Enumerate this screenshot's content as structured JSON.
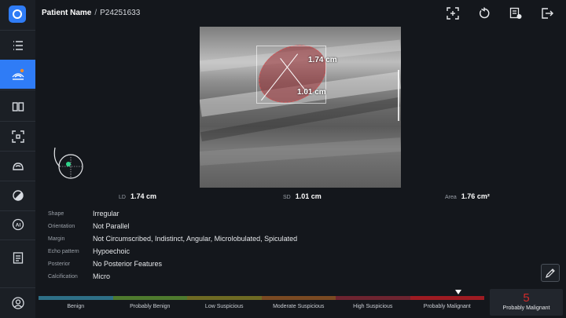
{
  "header": {
    "patient_label": "Patient Name",
    "separator": "/",
    "patient_id": "P24251633"
  },
  "sidebar": {
    "items": [
      {
        "icon": "list-icon"
      },
      {
        "icon": "ultrasound-probe-icon",
        "active": true
      },
      {
        "icon": "compare-icon"
      },
      {
        "icon": "focus-scan-icon"
      },
      {
        "icon": "breast-icon"
      },
      {
        "icon": "contrast-icon"
      },
      {
        "icon": "ai-icon"
      },
      {
        "icon": "clipboard-icon"
      },
      {
        "icon": "user-icon"
      }
    ]
  },
  "toolbar": {
    "icons": [
      "add-fullscreen-icon",
      "refresh-icon",
      "report-icon",
      "exit-icon"
    ]
  },
  "image": {
    "long_label": "1.74 cm",
    "short_label": "1.01 cm"
  },
  "measurements": {
    "ld_label": "LD",
    "ld_value": "1.74 cm",
    "sd_label": "SD",
    "sd_value": "1.01 cm",
    "area_label": "Area",
    "area_value": "1.76 cm²"
  },
  "descriptors": [
    {
      "label": "Shape",
      "value": "Irregular"
    },
    {
      "label": "Orientation",
      "value": "Not Parallel"
    },
    {
      "label": "Margin",
      "value": "Not Circumscribed, Indistinct, Angular, Microlobulated, Spiculated"
    },
    {
      "label": "Echo pattern",
      "value": "Hypoechoic"
    },
    {
      "label": "Posterior",
      "value": "No Posterior Features"
    },
    {
      "label": "Calcification",
      "value": "Micro"
    }
  ],
  "scale": {
    "categories": [
      "Benign",
      "Probably Benign",
      "Low Suspicious",
      "Moderate Suspicious",
      "High Suspicious",
      "Probably Malignant"
    ],
    "colors": [
      "#2e6f86",
      "#4e7a2e",
      "#6e6a23",
      "#7a4a22",
      "#6e2430",
      "#9e1b22"
    ],
    "selected_index": 5
  },
  "result": {
    "score": "5",
    "label": "Probably Malignant",
    "color": "#d12a2a"
  }
}
